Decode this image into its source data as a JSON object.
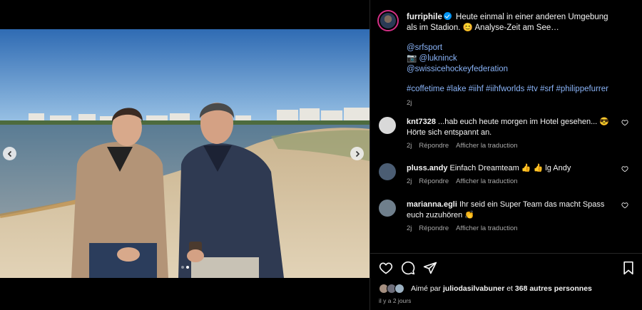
{
  "post": {
    "username": "furriphile",
    "caption_line1": "Heute einmal in einer anderen Umgebung als im Stadion. 😊 Analyse-Zeit am See…",
    "mention_srf": "@srfsport",
    "camera_emoji": "📷",
    "mention_luk": "@lukninck",
    "mention_fed": "@swissicehockeyfederation",
    "hashtags": "#coffetime #lake #iihf #iihfworlds #tv #srf #philippefurrer",
    "time": "2j"
  },
  "comments": [
    {
      "username": "knt7328",
      "text": "...hab euch heute morgen im Hotel gesehen... 😎 Hörte sich entspannt an.",
      "time": "2j",
      "reply": "Répondre",
      "translate": "Afficher la traduction",
      "avatar_color": "#d9d9d9"
    },
    {
      "username": "pluss.andy",
      "text": "Einfach Dreamteam 👍 👍 lg Andy",
      "time": "2j",
      "reply": "Répondre",
      "translate": "Afficher la traduction",
      "avatar_color": "#4b5d73"
    },
    {
      "username": "marianna.egli",
      "text": "Ihr seid ein Super Team das macht Spass euch zuzuhören 👏",
      "time": "2j",
      "reply": "Répondre",
      "translate": "Afficher la traduction",
      "avatar_color": "#6f7f8c"
    }
  ],
  "likes": {
    "prefix": "Aimé par",
    "user": "juliodasilvabuner",
    "connector": "et",
    "others": "368 autres personnes"
  },
  "post_time": "il y a 2 jours",
  "carousel": {
    "current": 1,
    "total": 2
  },
  "icons": [
    "chevron-left-icon",
    "chevron-right-icon",
    "verified-icon",
    "heart-icon",
    "comment-icon",
    "share-icon",
    "bookmark-icon"
  ],
  "colors": {
    "accent_link": "#8ab4f8",
    "verified": "#0095f6",
    "background": "#000000"
  }
}
